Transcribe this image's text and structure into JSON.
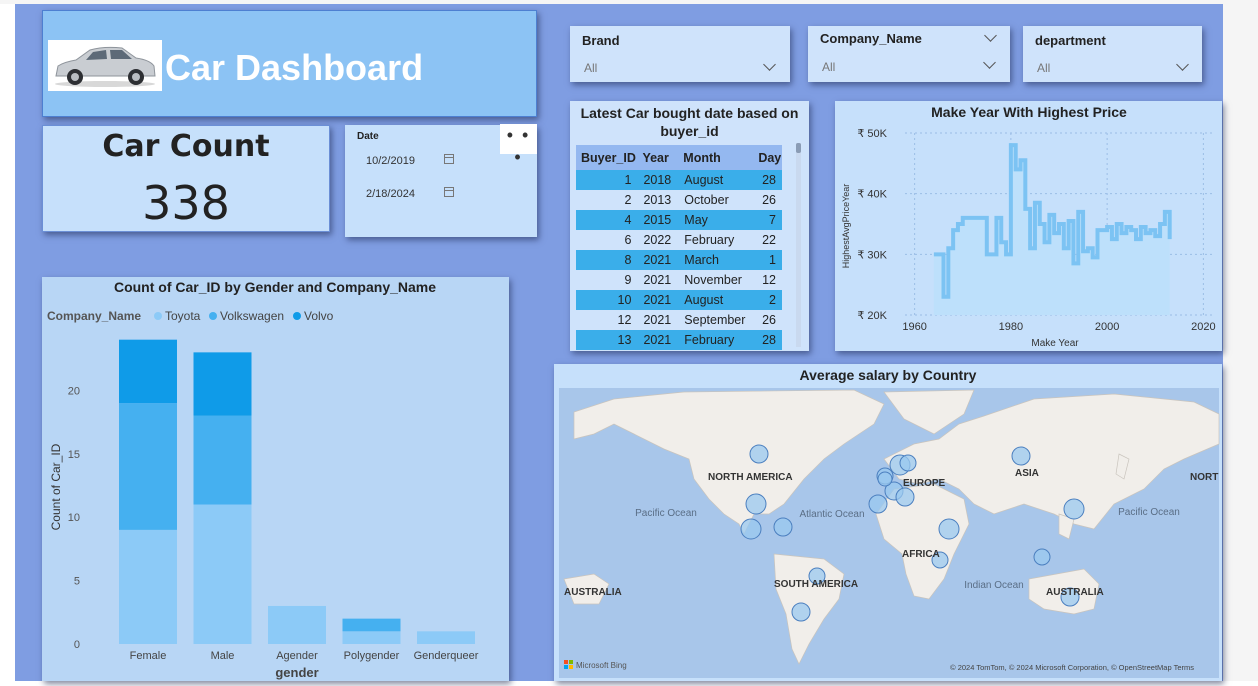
{
  "header": {
    "title": "Car Dashboard"
  },
  "card": {
    "label": "Car Count",
    "value": "338"
  },
  "date_slicer": {
    "label": "Date",
    "start": "10/2/2019",
    "end": "2/18/2024",
    "more": "• • •"
  },
  "slicers": [
    {
      "title": "Brand",
      "value": "All"
    },
    {
      "title": "Company_Name",
      "value": "All"
    },
    {
      "title": "department",
      "value": "All"
    }
  ],
  "table": {
    "title": "Latest Car bought date based on buyer_id",
    "columns": [
      "Buyer_ID",
      "Year",
      "Month",
      "Day"
    ],
    "rows": [
      [
        "1",
        "2018",
        "August",
        "28"
      ],
      [
        "2",
        "2013",
        "October",
        "26"
      ],
      [
        "4",
        "2015",
        "May",
        "7"
      ],
      [
        "6",
        "2022",
        "February",
        "22"
      ],
      [
        "8",
        "2021",
        "March",
        "1"
      ],
      [
        "9",
        "2021",
        "November",
        "12"
      ],
      [
        "10",
        "2021",
        "August",
        "2"
      ],
      [
        "12",
        "2021",
        "September",
        "26"
      ],
      [
        "13",
        "2021",
        "February",
        "28"
      ]
    ]
  },
  "line_chart": {
    "title": "Make Year With Highest Price",
    "ylabel": "HighestAvgPriceYear",
    "xlabel": "Make  Year",
    "yticks": [
      "₹ 50K",
      "₹ 40K",
      "₹ 30K",
      "₹ 20K"
    ],
    "xticks": [
      "1960",
      "1980",
      "2000",
      "2020"
    ]
  },
  "bar_chart": {
    "title": "Count of Car_ID by Gender and Company_Name",
    "legend_title": "Company_Name",
    "ylabel": "Count of Car_ID",
    "xlabel": "gender"
  },
  "map": {
    "title": "Average salary by Country",
    "labels": [
      "NORTH AMERICA",
      "EUROPE",
      "ASIA",
      "Pacific Ocean",
      "Atlantic Ocean",
      "AFRICA",
      "SOUTH AMERICA",
      "AUSTRALIA",
      "Indian Ocean",
      "AUSTRALIA",
      "Pacific Ocean",
      "NORT"
    ],
    "attribution": "© 2024 TomTom, © 2024 Microsoft Corporation, © OpenStreetMap  Terms",
    "logo": "Microsoft Bing"
  },
  "colors": {
    "toyota": "#8ccaf7",
    "volkswagen": "#45b0f0",
    "volvo": "#0f9be8",
    "line": "#7cc3f3",
    "area": "#bde0fb"
  },
  "chart_data": [
    {
      "type": "bar",
      "title": "Count of Car_ID by Gender and Company_Name",
      "xlabel": "gender",
      "ylabel": "Count of Car_ID",
      "categories": [
        "Female",
        "Male",
        "Agender",
        "Polygender",
        "Genderqueer"
      ],
      "series": [
        {
          "name": "Toyota",
          "values": [
            9,
            11,
            3,
            1,
            1
          ]
        },
        {
          "name": "Volkswagen",
          "values": [
            10,
            7,
            0,
            1,
            0
          ]
        },
        {
          "name": "Volvo",
          "values": [
            5,
            5,
            0,
            0,
            0
          ]
        }
      ],
      "ylim": [
        0,
        25
      ],
      "yticks": [
        0,
        5,
        10,
        15,
        20
      ],
      "stacked": true,
      "legend": "top-left"
    },
    {
      "type": "line",
      "title": "Make Year With Highest Price",
      "xlabel": "Make  Year",
      "ylabel": "HighestAvgPriceYear",
      "x": [
        1964,
        1966,
        1967,
        1968,
        1969,
        1970,
        1971,
        1975,
        1977,
        1978,
        1979,
        1980,
        1981,
        1982,
        1983,
        1984,
        1985,
        1986,
        1987,
        1988,
        1989,
        1990,
        1991,
        1992,
        1993,
        1994,
        1995,
        1996,
        1997,
        1998,
        1999,
        2000,
        2001,
        2002,
        2003,
        2004,
        2005,
        2006,
        2007,
        2008,
        2009,
        2010,
        2011,
        2012,
        2013
      ],
      "y": [
        30000,
        23000,
        31000,
        34000,
        35000,
        36000,
        36000,
        30000,
        36000,
        32000,
        30000,
        48000,
        44000,
        45500,
        37500,
        31000,
        38500,
        35000,
        32000,
        36500,
        33500,
        35000,
        31000,
        35500,
        28500,
        37000,
        30500,
        31000,
        29500,
        34000,
        34000,
        34500,
        32500,
        35000,
        33500,
        34500,
        34000,
        32500,
        34500,
        33500,
        34000,
        33000,
        35000,
        37000,
        32500
      ],
      "ylim": [
        20000,
        50000
      ],
      "xlim": [
        1958,
        2022
      ],
      "grid": true
    }
  ]
}
